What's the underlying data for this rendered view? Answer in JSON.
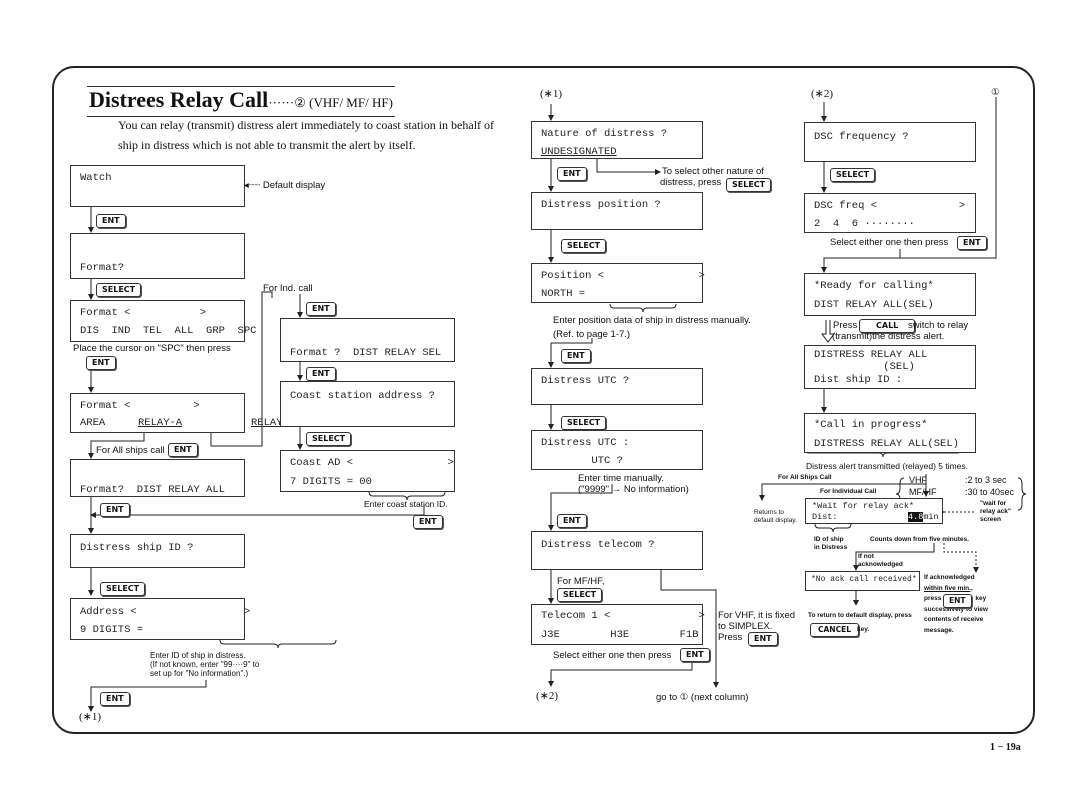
{
  "header": {
    "title": "Distrees Relay Call",
    "title_suffix": "······② (VHF/ MF/ HF)",
    "intro_line1": "You can relay (transmit) distress alert immediately to coast station in behalf of",
    "intro_line2": "ship in distress which is not able to transmit the alert by itself."
  },
  "keys": {
    "ent": "ENT",
    "select": "SELECT",
    "call": "CALL",
    "cancel": "CANCEL"
  },
  "col1": {
    "watch": "Watch",
    "default_display": "Default display",
    "format_q": "Format?",
    "format_sel_1": "Format <           >",
    "format_sel_2": "DIS  IND  TEL  ALL  GRP  SPC",
    "place_cursor": "Place the cursor on \"SPC\" then press",
    "format_relay_1": "Format <          >",
    "format_relay_area": "AREA",
    "format_relay_a": "RELAY-A",
    "format_relay_s": "RELAY-S",
    "for_all_ships": "For All ships call",
    "format_dist_all": "Format?  DIST RELAY ALL",
    "dist_ship_id": "Distress ship ID ?",
    "address_1": "Address <                 >",
    "address_2": "9 DIGITS =",
    "enter_id_1": "Enter ID of ship in distress.",
    "enter_id_2": "(If not known, enter \"99····9\" to",
    "enter_id_3": "set up for \"No information\".)",
    "ref_star1": "(∗1)"
  },
  "col2": {
    "for_ind_call": "For Ind. call",
    "format_dist_sel": "Format ?  DIST RELAY SEL",
    "coast_addr_q": "Coast station address ?",
    "coast_ad_1": "Coast AD <               >",
    "coast_ad_2": "7 DIGITS = 00",
    "enter_coast": "Enter coast station ID."
  },
  "col3": {
    "ref_star1": "(∗1)",
    "nature_q": "Nature of distress ?",
    "nature_val": "UNDESIGNATED",
    "nature_note_1": "To select other nature of",
    "nature_note_2": "distress, press",
    "dist_pos_q": "Distress position ?",
    "position_1": "Position <               >",
    "position_2": "NORTH =",
    "pos_note_1": "Enter position data of ship in distress manually.",
    "pos_note_2": "(Ref. to page 1-7.)",
    "utc_q": "Distress UTC ?",
    "utc_1": "Distress UTC :",
    "utc_2": "        UTC ?",
    "utc_note_1": "Enter time manually.",
    "utc_note_2": "(\"9999\" → No information)",
    "telecom_q": "Distress telecom ?",
    "for_mfhf": "For MF/HF,",
    "telecom_1": "Telecom 1 <              >",
    "telecom_2": "J3E        H3E        F1B",
    "select_either": "Select either one then press",
    "ref_star2": "(∗2)",
    "goto_next": "go to ① (next column)",
    "vhf_note_1": "For VHF, it is fixed",
    "vhf_note_2": "to SIMPLEX.",
    "vhf_note_3": "Press"
  },
  "col4": {
    "ref_star2": "(∗2)",
    "ref_circle1": "①",
    "dsc_freq_q": "DSC frequency ?",
    "dsc_freq_1": "DSC freq <             >",
    "dsc_freq_2": "2  4  6 ········",
    "select_either": "Select either one then press",
    "ready_1": "*Ready for calling*",
    "ready_2": "DIST RELAY ALL(SEL)",
    "press": "Press",
    "press_note_1": "switch to relay",
    "press_note_2": "(transmit)the distress alert.",
    "relay_all_1": "DISTRESS RELAY ALL",
    "relay_all_2": "           (SEL)",
    "relay_all_3": "Dist ship ID :",
    "progress_1": "*Call in progress*",
    "progress_2": "DISTRESS RELAY ALL(SEL)",
    "transmitted_note": "Distress alert transmitted (relayed) 5 times.",
    "for_all_ships_call": "For All Ships Call",
    "for_individual_call": "For Individual Call",
    "vhf": "VHF",
    "vhf_time": ":2 to 3 sec",
    "mfhf": "MF/HF",
    "mfhf_time": ":30 to 40sec",
    "wait_1": "*Wait for relay ack*",
    "wait_2": "Dist:",
    "wait_countdown": "4.8",
    "wait_unit": "min",
    "wait_screen_1": "\"wait for",
    "wait_screen_2": "relay ack\"",
    "wait_screen_3": "screen",
    "returns_1": "Returns to",
    "returns_2": "default display.",
    "id_ship_1": "ID of ship",
    "id_ship_2": "in Distress",
    "counts_down": "Counts down from five minutes.",
    "if_not_1": "If not",
    "if_not_2": "acknowledged",
    "no_ack": "*No ack call received*",
    "if_ack_1": "If acknowledged",
    "if_ack_2": "within five min.,",
    "if_ack_3": "press",
    "if_ack_4": "key",
    "if_ack_5": "successively to view",
    "if_ack_6": "contents of receive",
    "if_ack_7": "message.",
    "to_return": "To return to default display, press",
    "key_word": "key."
  },
  "footer": {
    "page_number": "1 − 19a"
  }
}
